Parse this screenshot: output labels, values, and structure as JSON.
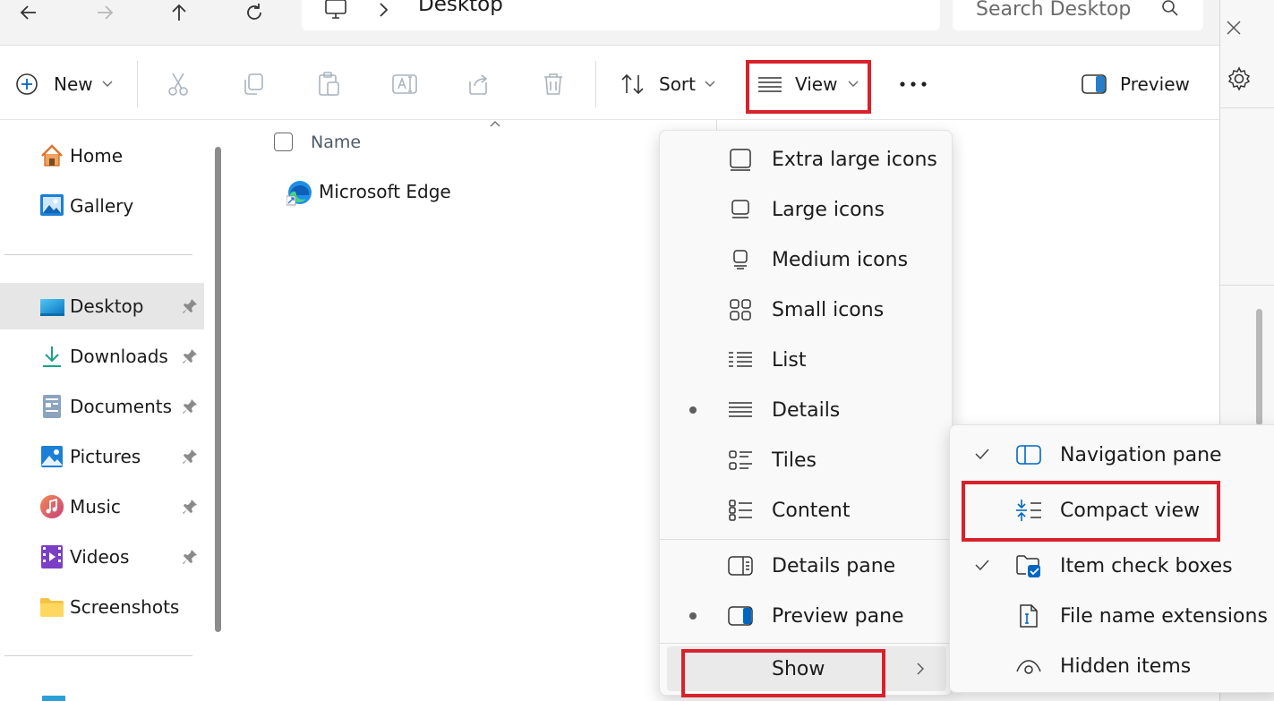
{
  "address_bar": {
    "location": "Desktop",
    "search_placeholder": "Search Desktop"
  },
  "toolbar": {
    "new_label": "New",
    "sort_label": "Sort",
    "view_label": "View",
    "preview_label": "Preview"
  },
  "sidebar": {
    "items": [
      {
        "label": "Home"
      },
      {
        "label": "Gallery"
      },
      {
        "label": "Desktop"
      },
      {
        "label": "Downloads"
      },
      {
        "label": "Documents"
      },
      {
        "label": "Pictures"
      },
      {
        "label": "Music"
      },
      {
        "label": "Videos"
      },
      {
        "label": "Screenshots"
      }
    ]
  },
  "file_list": {
    "column_name": "Name",
    "files": [
      {
        "name": "Microsoft Edge"
      }
    ]
  },
  "view_menu": {
    "items": [
      {
        "label": "Extra large icons",
        "selected": false
      },
      {
        "label": "Large icons",
        "selected": false
      },
      {
        "label": "Medium icons",
        "selected": false
      },
      {
        "label": "Small icons",
        "selected": false
      },
      {
        "label": "List",
        "selected": false
      },
      {
        "label": "Details",
        "selected": true
      },
      {
        "label": "Tiles",
        "selected": false
      },
      {
        "label": "Content",
        "selected": false
      },
      {
        "label": "Details pane",
        "selected": false
      },
      {
        "label": "Preview pane",
        "selected": true
      },
      {
        "label": "Show",
        "selected": false
      }
    ]
  },
  "show_submenu": {
    "items": [
      {
        "label": "Navigation pane",
        "checked": true
      },
      {
        "label": "Compact view",
        "checked": false
      },
      {
        "label": "Item check boxes",
        "checked": true
      },
      {
        "label": "File name extensions",
        "checked": false
      },
      {
        "label": "Hidden items",
        "checked": false
      }
    ]
  },
  "colors": {
    "highlight_red": "#d9212c",
    "accent_blue": "#0067c0"
  }
}
